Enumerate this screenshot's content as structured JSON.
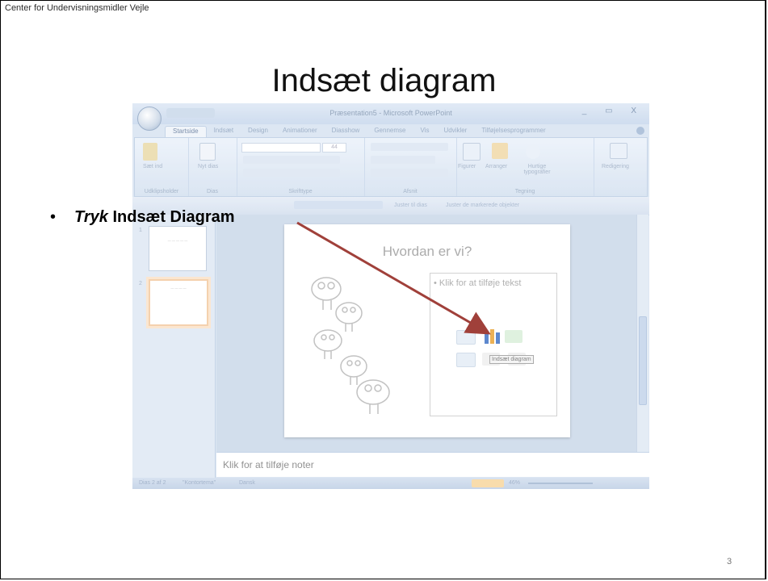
{
  "slide": {
    "org_text": "Center for Undervisningsmidler Vejle",
    "title": "Indsæt diagram",
    "bullet_dot": "•",
    "bullet_italic": "Tryk",
    "bullet_bold": " Indsæt Diagram",
    "page_number": "3"
  },
  "app": {
    "window_title": "Præsentation5 - Microsoft PowerPoint",
    "window_controls": "_ ▭ X",
    "tabs": [
      "Startside",
      "Indsæt",
      "Design",
      "Animationer",
      "Diasshow",
      "Gennemse",
      "Vis",
      "Udvikler",
      "Tilføjelsesprogrammer"
    ],
    "active_tab_index": 0,
    "ribbon_groups": [
      {
        "label": "Udklipsholder",
        "controls": [
          "Sæt ind"
        ]
      },
      {
        "label": "Dias",
        "controls": [
          "Nyt dias"
        ]
      },
      {
        "label": "Skrifttype",
        "controls": []
      },
      {
        "label": "Afsnit",
        "controls": []
      },
      {
        "label": "Tegning",
        "controls": [
          "Figurer",
          "Arranger",
          "Hurtige typografier"
        ]
      },
      {
        "label": "",
        "controls": [
          "Redigering"
        ]
      }
    ],
    "font_size": "44",
    "format_bar_item": "Juster til dias",
    "format_bar_item2": "Juster de markerede objekter",
    "slide_title": "Hvordan er vi?",
    "placeholder_text": "•  Klik for at tilføje tekst",
    "tooltip": "Indsæt diagram",
    "notes_placeholder": "Klik for at tilføje noter",
    "thumbnail_numbers": [
      "1",
      "2"
    ],
    "status": {
      "slide_position": "Dias 2 af 2",
      "theme": "\"Kontortema\"",
      "language": "Dansk",
      "zoom": "46%"
    }
  },
  "colors": {
    "arrow": "#a0403a",
    "ribbon_bg": "#d6e2f1"
  }
}
